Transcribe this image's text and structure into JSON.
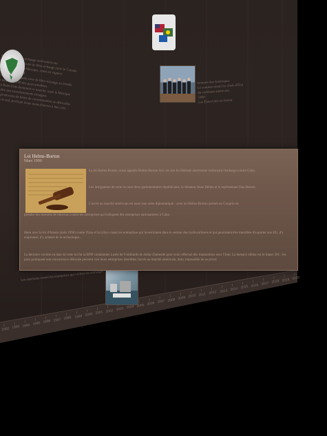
{
  "popup": {
    "title": "Loi Helms-Burton",
    "date": "Mars 1996",
    "paragraphs": [
      "La loi Helms-Burton, aussi appelée Helms-Burton Act, est une loi fédérale américaine renforçant l'embargo contre Cuba.",
      "Les instigateurs de cette loi sont deux parlementaires républicains, le sénateur Jesse Helms et le représentant Dan Burton.",
      "L'accès au marché américain est aussi une arme diplomatique : cette loi Helms-Burton permet au Congrès de",
      "prendre des mesures de rétorsion contre les entreprises qui trafiquent des entreprises nationalisées à Cuba.",
      "Idem avec la loi d'Amato (août 1996) contre l'Iran et la Libye visant les entreprises qui investiraient dans le secteur des hydrocarbures et qui pourraient être interdites d'exporter aux EU, d'y emprunter, d'y acheter de la technologie...",
      "La dernière victime en date de cette loi fut la BNP condamnée à près de 9 milliards de dollar d'amende pour avoir effectué des transactions avec l'Iran. La menace ultime est le Super 301 : les pays pratiquant une concurrence déloyale peuvent voir leurs entreprises interdites l'accès au marché américain, donc impossible de se priver"
    ]
  },
  "background": {
    "left_text": [
      "Accords de libre-échange nord-américain",
      "L'ALENA est un traité de libre-échange entre le Canada",
      "les États-Unis et le Mexique, entré en vigueur",
      "le 1er janvier 1994.",
      "Il crée la plus grande zone de libre-échange au monde",
      "en termes de PIB des pays membres.",
      "Les États-Unis dominent ce marché, mais le Mexique",
      "profite des investissements étrangers.",
      "La production de biens de consommation se délocalise",
      "vers le sud, profitant d'une main-d'œuvre à bas coût."
    ],
    "right_text": [
      "Sommet des Amériques",
      "Le sommet réunit les chefs d'État",
      "du continent américain.",
      "",
      "OMC",
      "",
      "Les États-Unis en faveur"
    ],
    "bottom_left": "Les sanctions contre les entreprises qui violent les embargos"
  },
  "timeline": {
    "ticks": [
      "1992",
      "1993",
      "1994",
      "1995",
      "1996",
      "1997",
      "1998",
      "1999",
      "2000",
      "2001",
      "2002",
      "2003",
      "2004",
      "2005",
      "2006",
      "2007",
      "2008",
      "2009",
      "2010",
      "2011",
      "2012",
      "2013",
      "2014",
      "2015",
      "2016",
      "2017",
      "2018",
      "2019",
      "2020"
    ]
  },
  "icons": {
    "globe": "north-america-globe-icon",
    "flags": "flags-icon",
    "gavel": "gavel-icon"
  },
  "colors": {
    "slab": "#2e2421",
    "popup": "#6d5649",
    "text_light": "#efe4da",
    "text_muted": "#b19a8c"
  }
}
